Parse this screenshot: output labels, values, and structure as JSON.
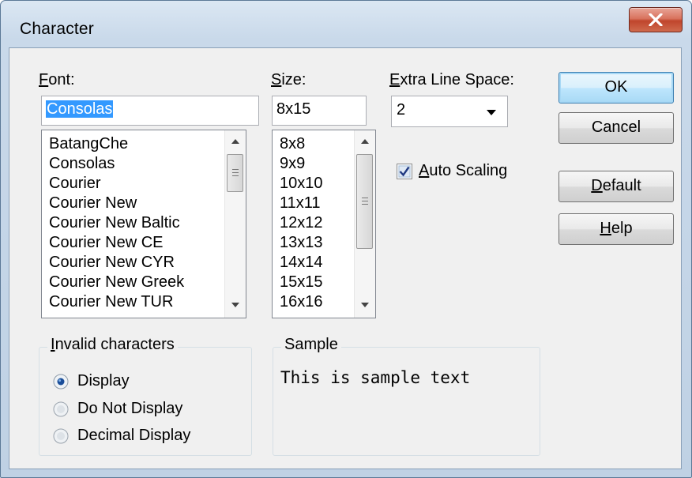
{
  "window": {
    "title": "Character"
  },
  "font": {
    "label": "Font:",
    "value": "Consolas",
    "items": [
      "BatangChe",
      "Consolas",
      "Courier",
      "Courier New",
      "Courier New Baltic",
      "Courier New CE",
      "Courier New CYR",
      "Courier New Greek",
      "Courier New TUR"
    ]
  },
  "size": {
    "label": "Size:",
    "value": "8x15",
    "items": [
      "8x8",
      "9x9",
      "10x10",
      "11x11",
      "12x12",
      "13x13",
      "14x14",
      "15x15",
      "16x16"
    ]
  },
  "line_space": {
    "label": "Extra Line Space:",
    "value": "2"
  },
  "auto_scaling": {
    "label": "Auto Scaling",
    "checked": true
  },
  "buttons": {
    "ok": "OK",
    "cancel": "Cancel",
    "default": "Default",
    "help": "Help"
  },
  "invalid": {
    "title": "Invalid characters",
    "options": [
      "Display",
      "Do Not Display",
      "Decimal Display"
    ],
    "selected": "Display"
  },
  "sample": {
    "title": "Sample",
    "text": "This is sample text"
  },
  "colors": {
    "selection": "#3399ff",
    "default_button_border": "#3c7fb1"
  }
}
